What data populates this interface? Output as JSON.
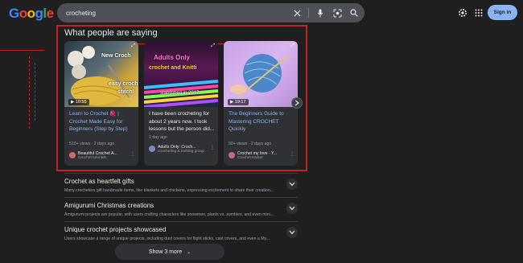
{
  "header": {
    "logo_letters": [
      "G",
      "o",
      "o",
      "g",
      "l",
      "e"
    ],
    "search_value": "crocheting",
    "signin_label": "Sign in",
    "icons": [
      "clear-icon",
      "mic-icon",
      "lens-icon",
      "search-icon",
      "settings-icon",
      "apps-icon"
    ]
  },
  "section": {
    "title": "What people are saying"
  },
  "cards": [
    {
      "overlay_lines": [
        "New Croch",
        "easy croch",
        "stitch!"
      ],
      "duration": "10:55",
      "title": "Learn to Crochet 🧶 | Crochet Made Easy for Beginners (Step by Step)",
      "title_color": "blue",
      "meta": "510+ views · 2 days ago",
      "author": "Beautiful Crochet A...",
      "author_sub": "Crochet tutorials",
      "avatar_color": "#d06b6b"
    },
    {
      "overlay_lines": [
        "Adults Only",
        "crochet and Knitti",
        "stablished in 2017"
      ],
      "duration": "",
      "title": "I have been crocheting for about 2 years now. I took lessons but the person did...",
      "title_color": "plain",
      "meta": "1 day ago",
      "author": "Adults Only: Croch...",
      "author_sub": "Crocheting & knitting group",
      "avatar_color": "#7b8cc4"
    },
    {
      "overlay_lines": [],
      "duration": "19:17",
      "title": "The Beginners Guide to Mastering CROCHET Quickly",
      "title_color": "blue",
      "meta": "90+ views · 2 days ago",
      "author": "Crochet my love · Y...",
      "author_sub": "Crochet trainer",
      "avatar_color": "#c26a8c"
    }
  ],
  "accordion": [
    {
      "title": "Crochet as heartfelt gifts",
      "desc": "Many crocheters gift handmade items, like blankets and chickens, expressing excitement to share their creation..."
    },
    {
      "title": "Amigurumi Christmas creations",
      "desc": "Amigurumi projects are popular, with users crafting characters like snowmen, plants vs. zombies, and even mini..."
    },
    {
      "title": "Unique crochet projects showcased",
      "desc": "Users showcase a range of unique projects, including dust covers for flight sticks, cast covers, and even a My..."
    }
  ],
  "show_more_label": "Show 3 more",
  "colors": {
    "background": "#1f1f1f",
    "card": "#303134",
    "link": "#8ab4f8",
    "annotation_red": "#c32127"
  }
}
